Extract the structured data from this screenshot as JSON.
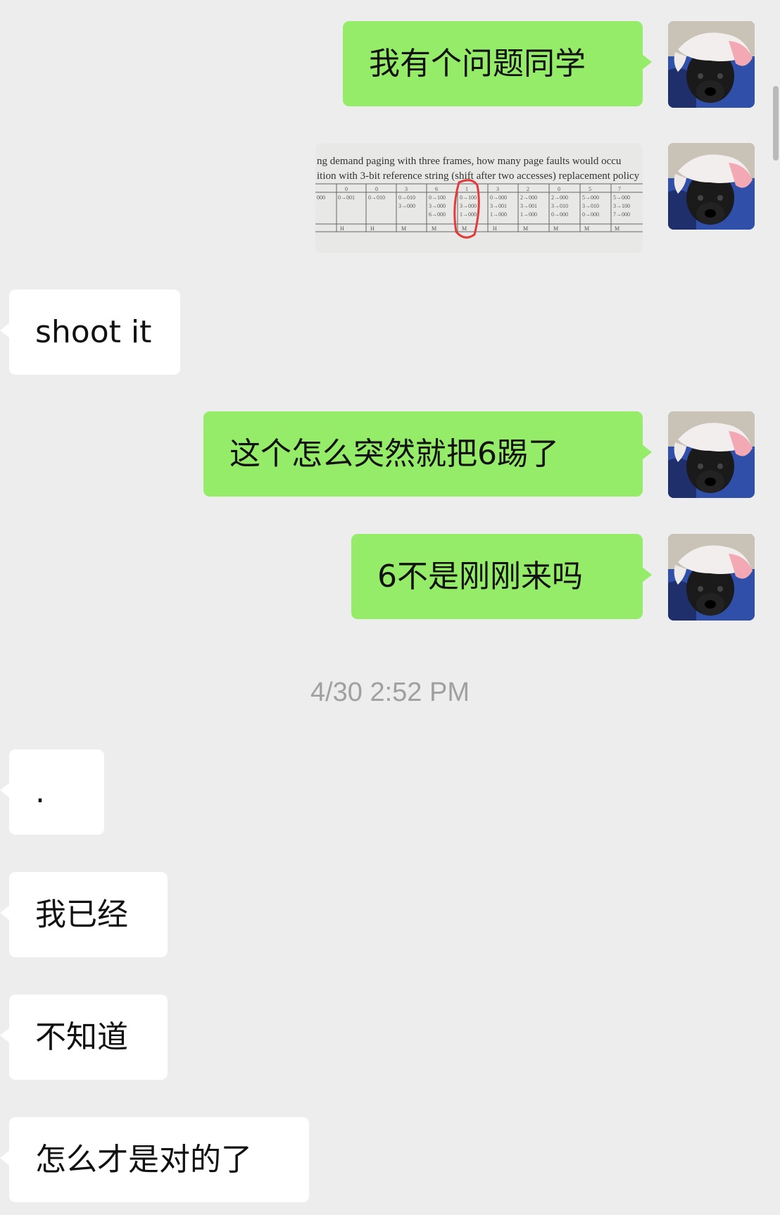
{
  "conversation": {
    "messages": [
      {
        "side": "out",
        "type": "text",
        "text": "我有个问题同学"
      },
      {
        "side": "out",
        "type": "image",
        "caption_line1": "ng demand paging with three frames, how many page faults would occu",
        "caption_line2": "ition with 3-bit reference string (shift after two accesses) replacement policy"
      },
      {
        "side": "in",
        "type": "text",
        "text": "shoot it"
      },
      {
        "side": "out",
        "type": "text",
        "text": "这个怎么突然就把6踢了"
      },
      {
        "side": "out",
        "type": "text",
        "text": "6不是刚刚来吗"
      },
      {
        "side": "in",
        "type": "text",
        "text": "."
      },
      {
        "side": "in",
        "type": "text",
        "text": "我已经"
      },
      {
        "side": "in",
        "type": "text",
        "text": "不知道"
      },
      {
        "side": "in",
        "type": "text",
        "text": "怎么才是对的了"
      }
    ],
    "timestamp": "4/30 2:52 PM"
  },
  "colors": {
    "background": "#ededed",
    "outgoing_bubble": "#95ec69",
    "incoming_bubble": "#ffffff",
    "timestamp_text": "#a0a0a0"
  },
  "icons": {
    "avatar": "dog-with-hat-avatar",
    "photo": "paging-table-photo"
  }
}
